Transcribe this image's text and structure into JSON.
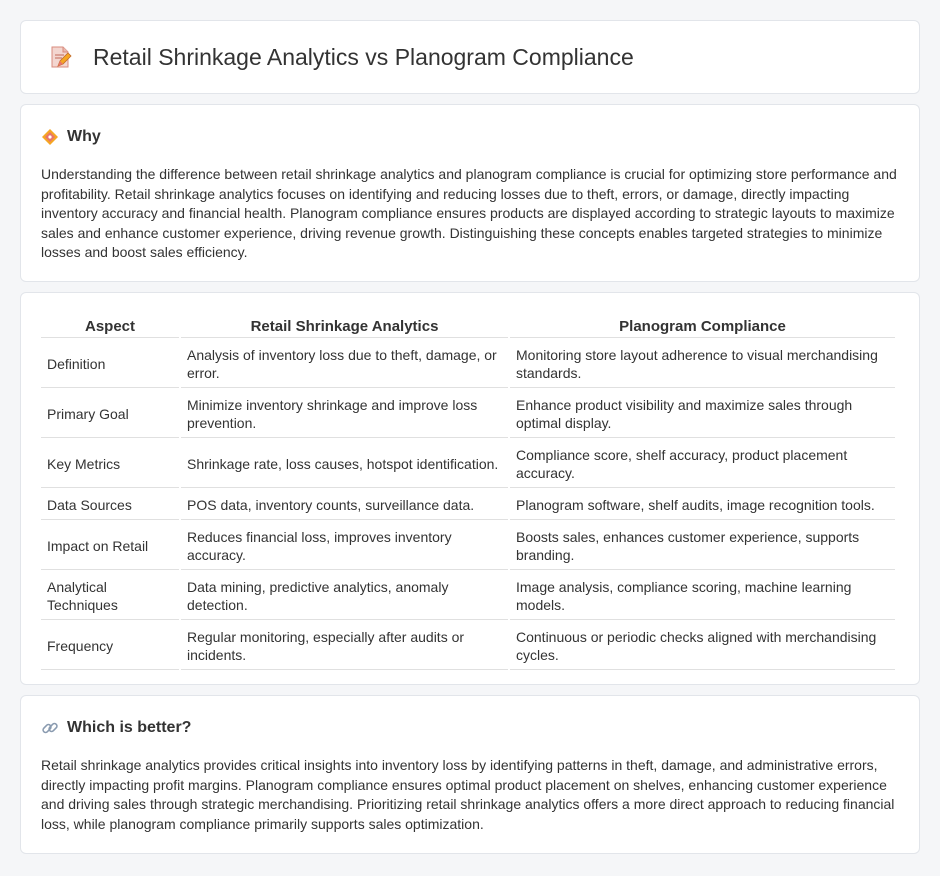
{
  "header": {
    "title": "Retail Shrinkage Analytics vs Planogram Compliance",
    "icon": "pencil-document-icon"
  },
  "why": {
    "icon": "diamond-warning-icon",
    "title": "Why",
    "text": "Understanding the difference between retail shrinkage analytics and planogram compliance is crucial for optimizing store performance and profitability. Retail shrinkage analytics focuses on identifying and reducing losses due to theft, errors, or damage, directly impacting inventory accuracy and financial health. Planogram compliance ensures products are displayed according to strategic layouts to maximize sales and enhance customer experience, driving revenue growth. Distinguishing these concepts enables targeted strategies to minimize losses and boost sales efficiency."
  },
  "table": {
    "headers": [
      "Aspect",
      "Retail Shrinkage Analytics",
      "Planogram Compliance"
    ],
    "rows": [
      {
        "aspect": "Definition",
        "a": "Analysis of inventory loss due to theft, damage, or error.",
        "b": "Monitoring store layout adherence to visual merchandising standards."
      },
      {
        "aspect": "Primary Goal",
        "a": "Minimize inventory shrinkage and improve loss prevention.",
        "b": "Enhance product visibility and maximize sales through optimal display."
      },
      {
        "aspect": "Key Metrics",
        "a": "Shrinkage rate, loss causes, hotspot identification.",
        "b": "Compliance score, shelf accuracy, product placement accuracy."
      },
      {
        "aspect": "Data Sources",
        "a": "POS data, inventory counts, surveillance data.",
        "b": "Planogram software, shelf audits, image recognition tools."
      },
      {
        "aspect": "Impact on Retail",
        "a": "Reduces financial loss, improves inventory accuracy.",
        "b": "Boosts sales, enhances customer experience, supports branding."
      },
      {
        "aspect": "Analytical Techniques",
        "a": "Data mining, predictive analytics, anomaly detection.",
        "b": "Image analysis, compliance scoring, machine learning models."
      },
      {
        "aspect": "Frequency",
        "a": "Regular monitoring, especially after audits or incidents.",
        "b": "Continuous or periodic checks aligned with merchandising cycles."
      }
    ]
  },
  "better": {
    "icon": "link-icon",
    "title": "Which is better?",
    "text": "Retail shrinkage analytics provides critical insights into inventory loss by identifying patterns in theft, damage, and administrative errors, directly impacting profit margins. Planogram compliance ensures optimal product placement on shelves, enhancing customer experience and driving sales through strategic merchandising. Prioritizing retail shrinkage analytics offers a more direct approach to reducing financial loss, while planogram compliance primarily supports sales optimization."
  }
}
